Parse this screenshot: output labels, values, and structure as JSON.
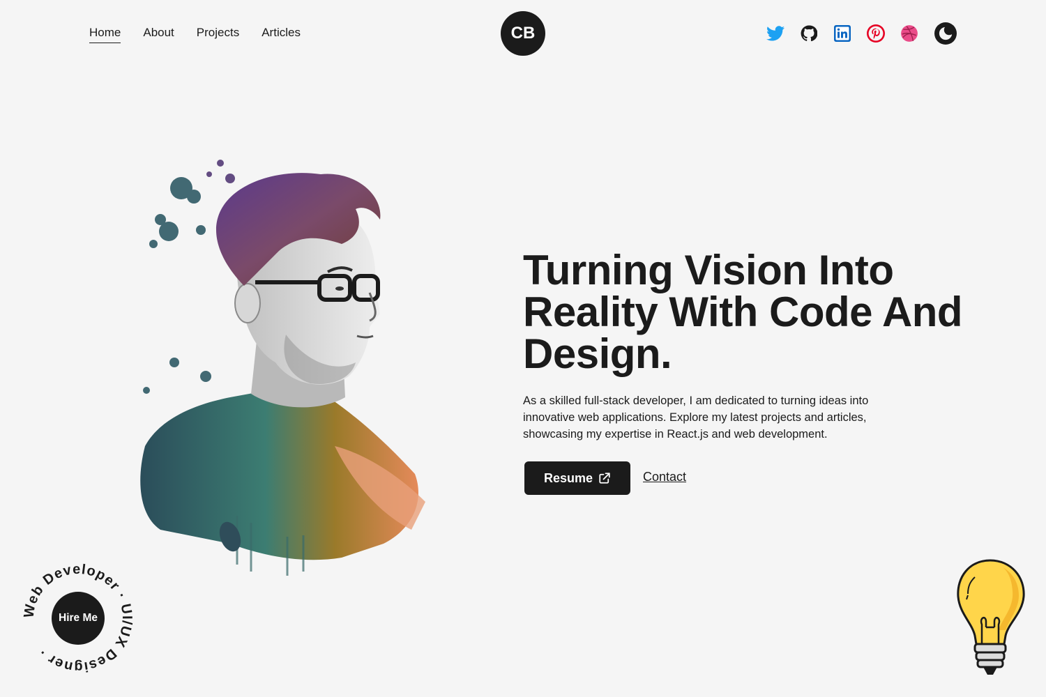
{
  "nav": {
    "links": [
      "Home",
      "About",
      "Projects",
      "Articles"
    ],
    "active": "Home",
    "logo": "CB"
  },
  "social": [
    {
      "icon": "twitter-icon",
      "color": "#1DA1F2"
    },
    {
      "icon": "github-icon",
      "color": "#1b1b1b"
    },
    {
      "icon": "linkedin-icon",
      "color": "#0A66C2"
    },
    {
      "icon": "pinterest-icon",
      "color": "#E60023"
    },
    {
      "icon": "dribbble-icon",
      "color": "#EA4C89"
    }
  ],
  "theme_toggle": {
    "icon": "moon-icon"
  },
  "hero": {
    "title": "Turning Vision Into Reality With Code And Design.",
    "description": "As a skilled full-stack developer, I am dedicated to turning ideas into innovative web applications. Explore my latest projects and articles, showcasing my expertise in React.js and web development.",
    "resume_label": "Resume",
    "contact_label": "Contact"
  },
  "hire": {
    "label": "Hire Me",
    "ring_text": "Web Developer · UI/UX Designer ·"
  },
  "colors": {
    "background": "#f5f5f5",
    "dark": "#1b1b1b",
    "bulb": "#FFD54A"
  }
}
